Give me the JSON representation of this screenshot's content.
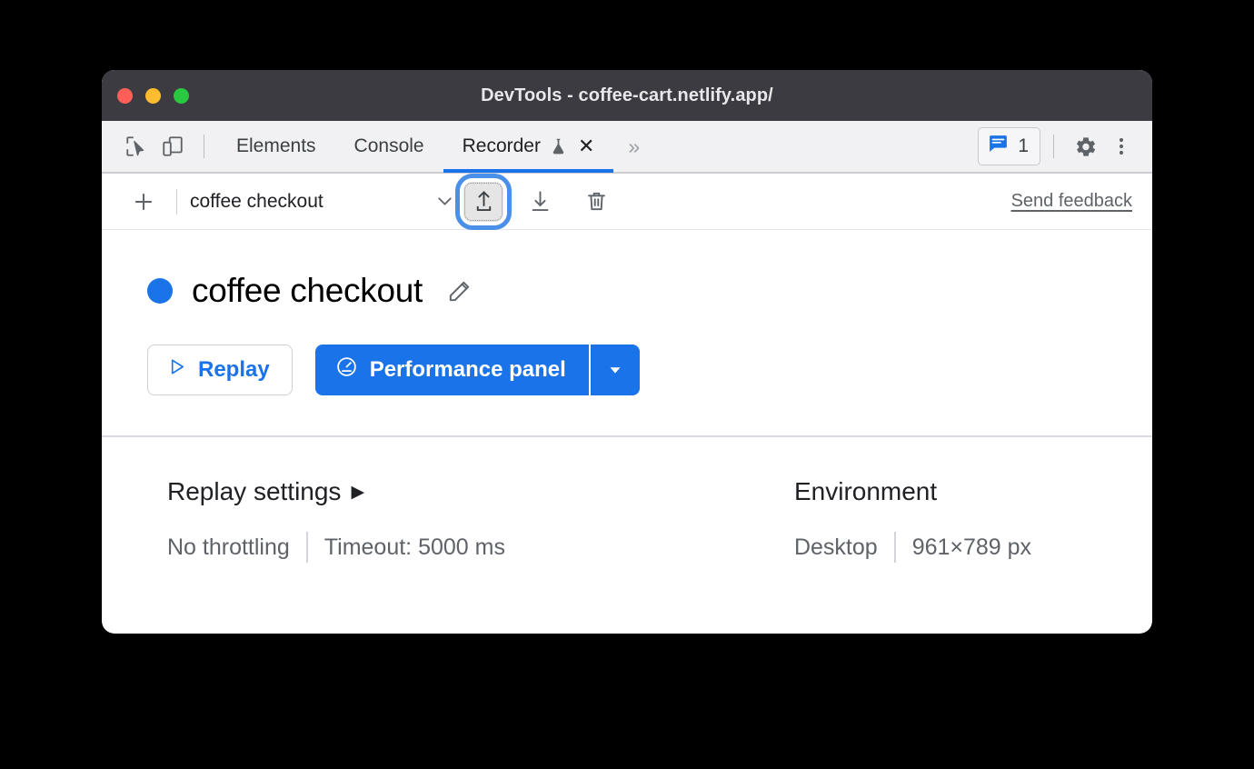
{
  "window": {
    "title": "DevTools - coffee-cart.netlify.app/",
    "traffic_lights": [
      {
        "name": "close",
        "color": "#ff5f57"
      },
      {
        "name": "minimize",
        "color": "#febc2e"
      },
      {
        "name": "maximize",
        "color": "#28c840"
      }
    ]
  },
  "tabbar": {
    "inspect_icon": "inspect-cursor-icon",
    "device_icon": "device-toolbar-icon",
    "tabs": [
      {
        "label": "Elements",
        "active": false
      },
      {
        "label": "Console",
        "active": false
      },
      {
        "label": "Recorder",
        "active": true,
        "experimental": true,
        "closable": true
      }
    ],
    "more_tabs_label": "»",
    "issues": {
      "icon": "issues-bubble-icon",
      "count": "1"
    },
    "settings_icon": "gear-icon",
    "more_icon": "three-dots-menu-icon"
  },
  "recorder_toolbar": {
    "add_label": "+",
    "recording_name": "coffee checkout",
    "select_caret": "chevron-down-icon",
    "import_label": "Import recording",
    "export_label": "Export recording",
    "delete_label": "Delete recording",
    "feedback_label": "Send feedback"
  },
  "recording": {
    "status_color": "#1a73e8",
    "title": "coffee checkout",
    "edit_icon": "pencil-icon",
    "replay_label": "Replay",
    "performance_label": "Performance panel",
    "performance_caret": "chevron-down-icon"
  },
  "settings": {
    "replay": {
      "heading": "Replay settings",
      "expander": "▶",
      "throttling": "No throttling",
      "timeout": "Timeout: 5000 ms"
    },
    "environment": {
      "heading": "Environment",
      "device": "Desktop",
      "viewport": "961×789 px"
    }
  },
  "colors": {
    "accent": "#1a73e8",
    "titlebar": "#3c3b42",
    "tabbar": "#f1f1f4",
    "focus_ring": "#4a90e8"
  }
}
